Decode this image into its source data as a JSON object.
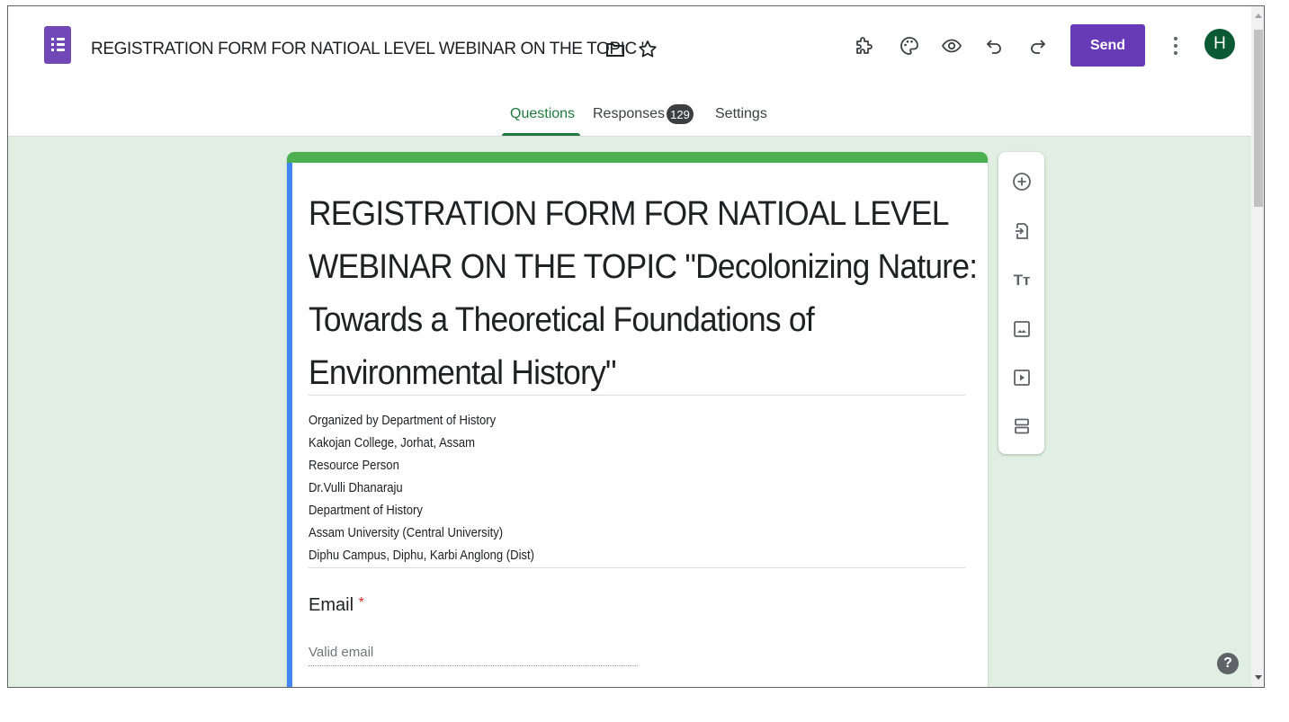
{
  "header": {
    "doc_title": "REGISTRATION FORM FOR NATIOAL LEVEL WEBINAR ON THE TOPIC '",
    "icons": [
      "folder-icon",
      "star-icon",
      "addon-puzzle-icon",
      "palette-icon",
      "preview-eye-icon",
      "undo-icon",
      "redo-icon"
    ],
    "send_label": "Send",
    "avatar_letter": "H",
    "brand_color": "#673ab7"
  },
  "tabs": {
    "questions": "Questions",
    "responses": "Responses",
    "responses_count": "129",
    "settings": "Settings",
    "active": "Questions"
  },
  "form": {
    "title_lines": [
      "REGISTRATION FORM FOR NATIOAL LEVEL",
      "WEBINAR ON THE TOPIC \"Decolonizing Nature:",
      "Towards a Theoretical Foundations of",
      "Environmental History\""
    ],
    "description_lines": [
      "Organized by Department of History",
      "Kakojan College, Jorhat, Assam",
      "Resource Person",
      "Dr.Vulli Dhanaraju",
      "Department of History",
      "Assam University (Central University)",
      "Diphu Campus, Diphu, Karbi Anglong (Dist)"
    ],
    "question": {
      "label": "Email",
      "required_marker": "*",
      "placeholder": "Valid email"
    },
    "theme_color": "#4caf50",
    "background_color": "#e0efe2"
  },
  "side_toolbar": {
    "icons": [
      "add-question-icon",
      "import-questions-icon",
      "add-title-icon",
      "add-image-icon",
      "add-video-icon",
      "add-section-icon"
    ],
    "title_glyph": "Tт"
  },
  "help_glyph": "?"
}
